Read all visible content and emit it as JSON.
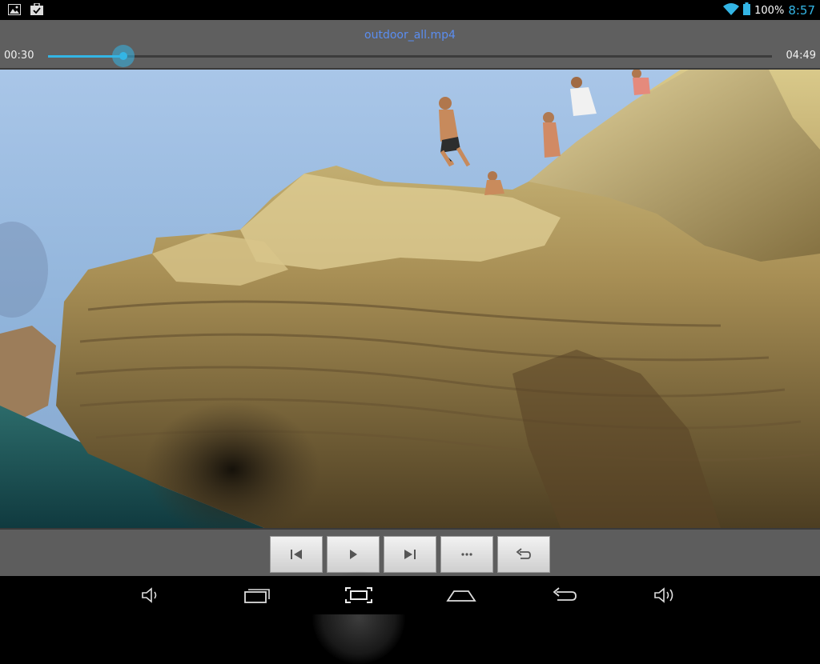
{
  "status_bar": {
    "left_icons": [
      "gallery-icon",
      "briefcase-icon"
    ],
    "battery": "100%",
    "time": "8:57"
  },
  "player": {
    "title": "outdoor_all.mp4",
    "current_time": "00:30",
    "total_time": "04:49",
    "progress_fraction": 0.104
  },
  "controls": [
    {
      "name": "previous-button",
      "icon": "skip-previous-icon"
    },
    {
      "name": "play-button",
      "icon": "play-icon"
    },
    {
      "name": "next-button",
      "icon": "skip-next-icon"
    },
    {
      "name": "more-button",
      "icon": "more-dots-icon"
    },
    {
      "name": "return-button",
      "icon": "undo-icon"
    }
  ],
  "nav_bar": [
    "volume-down-icon",
    "recent-apps-icon",
    "screenshot-icon",
    "home-icon",
    "back-icon",
    "volume-up-icon"
  ],
  "colors": {
    "accent": "#33b5e5",
    "title": "#5a8df0"
  }
}
